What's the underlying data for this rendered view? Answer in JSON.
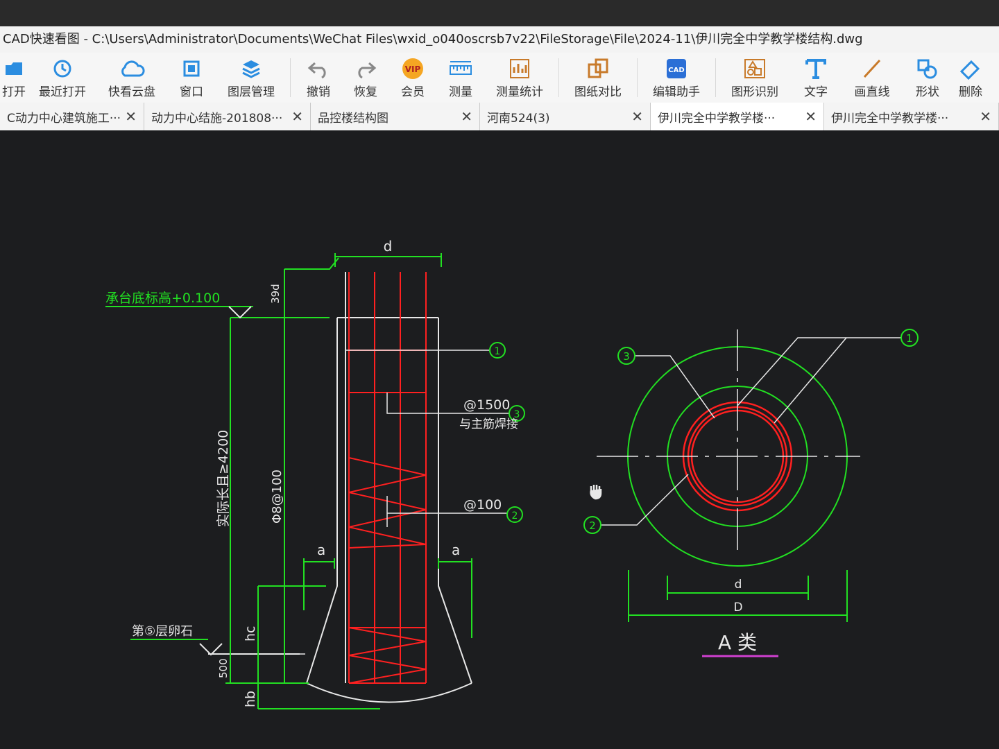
{
  "window": {
    "title": "CAD快速看图 - C:\\Users\\Administrator\\Documents\\WeChat Files\\wxid_o040oscrsb7v22\\FileStorage\\File\\2024-11\\伊川完全中学教学楼结构.dwg"
  },
  "toolbar": {
    "items": [
      {
        "label": "打开",
        "icon": "folder-icon"
      },
      {
        "label": "最近打开",
        "icon": "history-icon"
      },
      {
        "label": "快看云盘",
        "icon": "cloud-icon"
      },
      {
        "label": "窗口",
        "icon": "window-icon"
      },
      {
        "label": "图层管理",
        "icon": "layers-icon"
      },
      {
        "label": "撤销",
        "icon": "undo-icon"
      },
      {
        "label": "恢复",
        "icon": "redo-icon"
      },
      {
        "label": "会员",
        "icon": "vip-icon"
      },
      {
        "label": "测量",
        "icon": "ruler-icon"
      },
      {
        "label": "测量统计",
        "icon": "measure-stats-icon"
      },
      {
        "label": "图纸对比",
        "icon": "compare-icon"
      },
      {
        "label": "编辑助手",
        "icon": "edit-assistant-icon"
      },
      {
        "label": "图形识别",
        "icon": "shape-recognize-icon"
      },
      {
        "label": "文字",
        "icon": "text-icon"
      },
      {
        "label": "画直线",
        "icon": "line-icon"
      },
      {
        "label": "形状",
        "icon": "shapes-icon"
      },
      {
        "label": "删除",
        "icon": "erase-icon"
      }
    ]
  },
  "tabs": [
    {
      "label": "C动力中心建筑施工···"
    },
    {
      "label": "动力中心结施-201808···"
    },
    {
      "label": "品控楼结构图"
    },
    {
      "label": "河南524(3)"
    },
    {
      "label": "伊川完全中学教学楼···"
    },
    {
      "label": "伊川完全中学教学楼···"
    }
  ],
  "drawing": {
    "dim_d_top": "d",
    "dim_39d": "39d",
    "elev_label": "承台底标高+0.100",
    "pile_len": "实际长且≥4200",
    "stirrup_spec": "Φ8@100",
    "callout1": "1",
    "callout2": "2",
    "callout3": "3",
    "note_1500": "@1500",
    "note_weld": "与主筋焊接",
    "note_100": "@100",
    "dim_a_left": "a",
    "dim_a_right": "a",
    "bearing_layer": "第⑤层卵石",
    "dim_hc": "hc",
    "dim_500": "500",
    "dim_hb": "hb",
    "sec_d": "d",
    "sec_D": "D",
    "section_title": "A 类"
  },
  "colors": {
    "cad_background": "#1c1d1f",
    "green": "#22e022",
    "red": "#ff2020",
    "white": "#e8e8e8",
    "magenta": "#d040d0"
  }
}
